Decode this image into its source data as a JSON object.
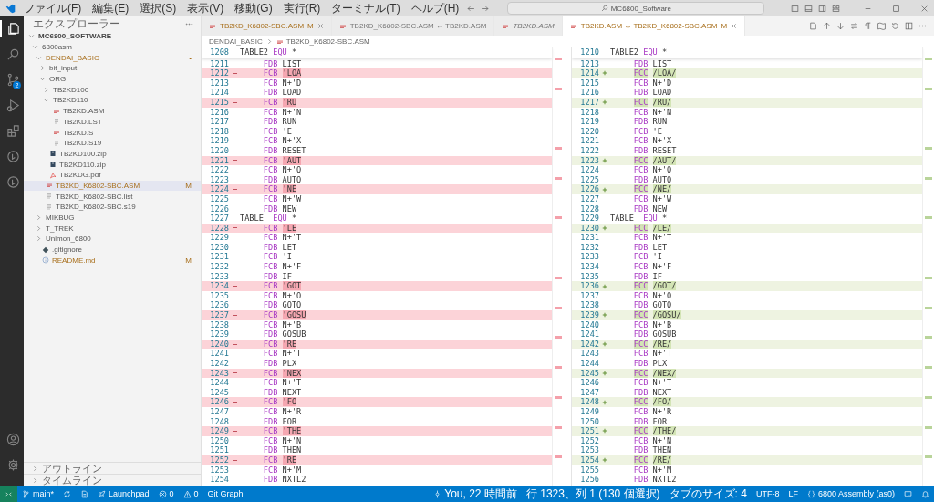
{
  "title_bar": {
    "menus": [
      "ファイル(F)",
      "編集(E)",
      "選択(S)",
      "表示(V)",
      "移動(G)",
      "実行(R)",
      "ターミナル(T)",
      "ヘルプ(H)"
    ],
    "search": {
      "value": "MC6800_Software"
    }
  },
  "activity_bar": {
    "items": [
      {
        "kind": "explorer",
        "selected": true
      },
      {
        "kind": "search",
        "selected": false
      },
      {
        "kind": "scm",
        "selected": false,
        "badge": "2"
      },
      {
        "kind": "run",
        "selected": false
      },
      {
        "kind": "extensions",
        "selected": false
      },
      {
        "kind": "circle",
        "selected": false
      },
      {
        "kind": "circle",
        "selected": false
      }
    ],
    "bottom": [
      {
        "kind": "account"
      },
      {
        "kind": "settings"
      }
    ]
  },
  "explorer": {
    "title": "エクスプローラー",
    "tree": [
      {
        "name": "MC6800_SOFTWARE",
        "kind": "root",
        "expanded": true,
        "selected": false,
        "children": [
          {
            "name": "6800asm",
            "kind": "folder",
            "expanded": true,
            "selected": false,
            "children": [
              {
                "name": "DENDAI_BASIC",
                "kind": "folder",
                "expanded": true,
                "selected": false,
                "badge": "•",
                "children": [
                  {
                    "name": "bit_input",
                    "kind": "folder",
                    "expanded": false,
                    "selected": false
                  },
                  {
                    "name": "ORG",
                    "kind": "folder",
                    "expanded": true,
                    "selected": false,
                    "children": [
                      {
                        "name": "TB2KD100",
                        "kind": "folder",
                        "expanded": false,
                        "selected": false
                      },
                      {
                        "name": "TB2KD110",
                        "kind": "folder",
                        "expanded": true,
                        "selected": false,
                        "children": [
                          {
                            "name": "TB2KD.ASM",
                            "kind": "asm",
                            "selected": false
                          },
                          {
                            "name": "TB2KD.LST",
                            "kind": "text",
                            "selected": false
                          },
                          {
                            "name": "TB2KD.S",
                            "kind": "asm",
                            "selected": false
                          },
                          {
                            "name": "TB2KD.S19",
                            "kind": "text",
                            "selected": false
                          }
                        ]
                      },
                      {
                        "name": "TB2KD100.zip",
                        "kind": "zip",
                        "selected": false
                      },
                      {
                        "name": "TB2KD110.zip",
                        "kind": "zip",
                        "selected": false
                      },
                      {
                        "name": "TB2KDG.pdf",
                        "kind": "pdf",
                        "selected": false
                      }
                    ]
                  },
                  {
                    "name": "TB2KD_K6802-SBC.ASM",
                    "kind": "asm",
                    "selected": true,
                    "badge": "M"
                  },
                  {
                    "name": "TB2KD_K6802-SBC.list",
                    "kind": "text",
                    "selected": false
                  },
                  {
                    "name": "TB2KD_K6802-SBC.s19",
                    "kind": "text",
                    "selected": false
                  }
                ]
              },
              {
                "name": "MIKBUG",
                "kind": "folder",
                "expanded": false,
                "selected": false
              },
              {
                "name": "T_TREK",
                "kind": "folder",
                "expanded": false,
                "selected": false
              },
              {
                "name": "Unimon_6800",
                "kind": "folder",
                "expanded": false,
                "selected": false
              },
              {
                "name": ".gitignore",
                "kind": "git",
                "selected": false
              },
              {
                "name": "README.md",
                "kind": "info",
                "selected": false,
                "badge": "M"
              }
            ]
          }
        ]
      }
    ],
    "sections": [
      {
        "title": "アウトライン",
        "expanded": false
      },
      {
        "title": "タイムライン",
        "expanded": false
      }
    ]
  },
  "tabs": [
    {
      "label": "TB2KD_K6802-SBC.ASM",
      "badge": "M",
      "close_button": true,
      "preview": false,
      "selected": false
    },
    {
      "label": "TB2KD_K6802-SBC.ASM ↔ TB2KD.ASM",
      "close_button": false,
      "preview": false,
      "selected": false
    },
    {
      "label": "TB2KD.ASM",
      "close_button": false,
      "preview": true,
      "selected": false
    },
    {
      "label": "TB2KD.ASM ↔ TB2KD_K6802-SBC.ASM",
      "badge": "M",
      "close_button": true,
      "preview": false,
      "selected": true
    }
  ],
  "breadcrumb": [
    "DENDAI_BASIC",
    "TB2KD_K6802-SBC.ASM"
  ],
  "panes": [
    {
      "sticky": {
        "n": "1208",
        "label": "TABLE2",
        "op": "EQU",
        "arg": "*"
      },
      "lines": [
        {
          "n": "1211",
          "kind": "same",
          "op": "FDB",
          "arg": "LIST"
        },
        {
          "n": "1212",
          "kind": "removed",
          "op": "FCB",
          "arg": "'LOA"
        },
        {
          "n": "1213",
          "kind": "same",
          "op": "FCB",
          "arg": "N+'D"
        },
        {
          "n": "1214",
          "kind": "same",
          "op": "FDB",
          "arg": "LOAD"
        },
        {
          "n": "1215",
          "kind": "removed",
          "op": "FCB",
          "arg": "'RU"
        },
        {
          "n": "1216",
          "kind": "same",
          "op": "FCB",
          "arg": "N+'N"
        },
        {
          "n": "1217",
          "kind": "same",
          "op": "FDB",
          "arg": "RUN"
        },
        {
          "n": "1218",
          "kind": "same",
          "op": "FCB",
          "arg": "'E"
        },
        {
          "n": "1219",
          "kind": "same",
          "op": "FCB",
          "arg": "N+'X"
        },
        {
          "n": "1220",
          "kind": "same",
          "op": "FDB",
          "arg": "RESET"
        },
        {
          "n": "1221",
          "kind": "removed",
          "op": "FCB",
          "arg": "'AUT"
        },
        {
          "n": "1222",
          "kind": "same",
          "op": "FCB",
          "arg": "N+'O"
        },
        {
          "n": "1223",
          "kind": "same",
          "op": "FDB",
          "arg": "AUTO"
        },
        {
          "n": "1224",
          "kind": "removed",
          "op": "FCB",
          "arg": "'NE"
        },
        {
          "n": "1225",
          "kind": "same",
          "op": "FCB",
          "arg": "N+'W"
        },
        {
          "n": "1226",
          "kind": "same",
          "op": "FDB",
          "arg": "NEW"
        },
        {
          "n": "1227",
          "kind": "same",
          "label": "TABLE",
          "op": "EQU",
          "arg": "*"
        },
        {
          "n": "1228",
          "kind": "removed",
          "op": "FCB",
          "arg": "'LE"
        },
        {
          "n": "1229",
          "kind": "same",
          "op": "FCB",
          "arg": "N+'T"
        },
        {
          "n": "1230",
          "kind": "same",
          "op": "FDB",
          "arg": "LET"
        },
        {
          "n": "1231",
          "kind": "same",
          "op": "FCB",
          "arg": "'I"
        },
        {
          "n": "1232",
          "kind": "same",
          "op": "FCB",
          "arg": "N+'F"
        },
        {
          "n": "1233",
          "kind": "same",
          "op": "FDB",
          "arg": "IF"
        },
        {
          "n": "1234",
          "kind": "removed",
          "op": "FCB",
          "arg": "'GOT"
        },
        {
          "n": "1235",
          "kind": "same",
          "op": "FCB",
          "arg": "N+'O"
        },
        {
          "n": "1236",
          "kind": "same",
          "op": "FDB",
          "arg": "GOTO"
        },
        {
          "n": "1237",
          "kind": "removed",
          "op": "FCB",
          "arg": "'GOSU"
        },
        {
          "n": "1238",
          "kind": "same",
          "op": "FCB",
          "arg": "N+'B"
        },
        {
          "n": "1239",
          "kind": "same",
          "op": "FDB",
          "arg": "GOSUB"
        },
        {
          "n": "1240",
          "kind": "removed",
          "op": "FCB",
          "arg": "'RE"
        },
        {
          "n": "1241",
          "kind": "same",
          "op": "FCB",
          "arg": "N+'T"
        },
        {
          "n": "1242",
          "kind": "same",
          "op": "FDB",
          "arg": "PLX"
        },
        {
          "n": "1243",
          "kind": "removed",
          "op": "FCB",
          "arg": "'NEX"
        },
        {
          "n": "1244",
          "kind": "same",
          "op": "FCB",
          "arg": "N+'T"
        },
        {
          "n": "1245",
          "kind": "same",
          "op": "FDB",
          "arg": "NEXT"
        },
        {
          "n": "1246",
          "kind": "removed",
          "op": "FCB",
          "arg": "'FO"
        },
        {
          "n": "1247",
          "kind": "same",
          "op": "FCB",
          "arg": "N+'R"
        },
        {
          "n": "1248",
          "kind": "same",
          "op": "FDB",
          "arg": "FOR"
        },
        {
          "n": "1249",
          "kind": "removed",
          "op": "FCB",
          "arg": "'THE"
        },
        {
          "n": "1250",
          "kind": "same",
          "op": "FCB",
          "arg": "N+'N"
        },
        {
          "n": "1251",
          "kind": "same",
          "op": "FDB",
          "arg": "THEN"
        },
        {
          "n": "1252",
          "kind": "removed",
          "op": "FCB",
          "arg": "'RE"
        },
        {
          "n": "1253",
          "kind": "same",
          "op": "FCB",
          "arg": "N+'M"
        },
        {
          "n": "1254",
          "kind": "same",
          "op": "FDB",
          "arg": "NXTL2"
        }
      ]
    },
    {
      "sticky": {
        "n": "1210",
        "label": "TABLE2",
        "op": "EQU",
        "arg": "*"
      },
      "lines": [
        {
          "n": "1213",
          "kind": "same",
          "op": "FDB",
          "arg": "LIST"
        },
        {
          "n": "1214",
          "kind": "added",
          "op": "FCC",
          "arg": "/LOA/"
        },
        {
          "n": "1215",
          "kind": "same",
          "op": "FCB",
          "arg": "N+'D"
        },
        {
          "n": "1216",
          "kind": "same",
          "op": "FDB",
          "arg": "LOAD"
        },
        {
          "n": "1217",
          "kind": "added",
          "op": "FCC",
          "arg": "/RU/"
        },
        {
          "n": "1218",
          "kind": "same",
          "op": "FCB",
          "arg": "N+'N"
        },
        {
          "n": "1219",
          "kind": "same",
          "op": "FDB",
          "arg": "RUN"
        },
        {
          "n": "1220",
          "kind": "same",
          "op": "FCB",
          "arg": "'E"
        },
        {
          "n": "1221",
          "kind": "same",
          "op": "FCB",
          "arg": "N+'X"
        },
        {
          "n": "1222",
          "kind": "same",
          "op": "FDB",
          "arg": "RESET"
        },
        {
          "n": "1223",
          "kind": "added",
          "op": "FCC",
          "arg": "/AUT/"
        },
        {
          "n": "1224",
          "kind": "same",
          "op": "FCB",
          "arg": "N+'O"
        },
        {
          "n": "1225",
          "kind": "same",
          "op": "FDB",
          "arg": "AUTO"
        },
        {
          "n": "1226",
          "kind": "added",
          "op": "FCC",
          "arg": "/NE/"
        },
        {
          "n": "1227",
          "kind": "same",
          "op": "FCB",
          "arg": "N+'W"
        },
        {
          "n": "1228",
          "kind": "same",
          "op": "FDB",
          "arg": "NEW"
        },
        {
          "n": "1229",
          "kind": "same",
          "label": "TABLE",
          "op": "EQU",
          "arg": "*"
        },
        {
          "n": "1230",
          "kind": "added",
          "op": "FCC",
          "arg": "/LE/"
        },
        {
          "n": "1231",
          "kind": "same",
          "op": "FCB",
          "arg": "N+'T"
        },
        {
          "n": "1232",
          "kind": "same",
          "op": "FDB",
          "arg": "LET"
        },
        {
          "n": "1233",
          "kind": "same",
          "op": "FCB",
          "arg": "'I"
        },
        {
          "n": "1234",
          "kind": "same",
          "op": "FCB",
          "arg": "N+'F"
        },
        {
          "n": "1235",
          "kind": "same",
          "op": "FDB",
          "arg": "IF"
        },
        {
          "n": "1236",
          "kind": "added",
          "op": "FCC",
          "arg": "/GOT/"
        },
        {
          "n": "1237",
          "kind": "same",
          "op": "FCB",
          "arg": "N+'O"
        },
        {
          "n": "1238",
          "kind": "same",
          "op": "FDB",
          "arg": "GOTO"
        },
        {
          "n": "1239",
          "kind": "added",
          "op": "FCC",
          "arg": "/GOSU/"
        },
        {
          "n": "1240",
          "kind": "same",
          "op": "FCB",
          "arg": "N+'B"
        },
        {
          "n": "1241",
          "kind": "same",
          "op": "FDB",
          "arg": "GOSUB"
        },
        {
          "n": "1242",
          "kind": "added",
          "op": "FCC",
          "arg": "/RE/"
        },
        {
          "n": "1243",
          "kind": "same",
          "op": "FCB",
          "arg": "N+'T"
        },
        {
          "n": "1244",
          "kind": "same",
          "op": "FDB",
          "arg": "PLX"
        },
        {
          "n": "1245",
          "kind": "added",
          "op": "FCC",
          "arg": "/NEX/"
        },
        {
          "n": "1246",
          "kind": "same",
          "op": "FCB",
          "arg": "N+'T"
        },
        {
          "n": "1247",
          "kind": "same",
          "op": "FDB",
          "arg": "NEXT"
        },
        {
          "n": "1248",
          "kind": "added",
          "op": "FCC",
          "arg": "/FO/"
        },
        {
          "n": "1249",
          "kind": "same",
          "op": "FCB",
          "arg": "N+'R"
        },
        {
          "n": "1250",
          "kind": "same",
          "op": "FDB",
          "arg": "FOR"
        },
        {
          "n": "1251",
          "kind": "added",
          "op": "FCC",
          "arg": "/THE/"
        },
        {
          "n": "1252",
          "kind": "same",
          "op": "FCB",
          "arg": "N+'N"
        },
        {
          "n": "1253",
          "kind": "same",
          "op": "FDB",
          "arg": "THEN"
        },
        {
          "n": "1254",
          "kind": "added",
          "op": "FCC",
          "arg": "/RE/"
        },
        {
          "n": "1255",
          "kind": "same",
          "op": "FCB",
          "arg": "N+'M"
        },
        {
          "n": "1256",
          "kind": "same",
          "op": "FDB",
          "arg": "NXTL2"
        }
      ]
    }
  ],
  "status_bar": {
    "left": [
      {
        "kind": "remote"
      },
      {
        "kind": "branch",
        "text": "main*"
      },
      {
        "kind": "sync"
      },
      {
        "kind": "doc"
      },
      {
        "kind": "launch",
        "text": "Launchpad"
      },
      {
        "kind": "error",
        "text": "0"
      },
      {
        "kind": "warning",
        "text": "0"
      },
      {
        "kind": "plain",
        "text": "Git Graph"
      }
    ],
    "right": [
      {
        "kind": "commit",
        "text": "You, 22 時間前"
      },
      {
        "kind": "plain",
        "text": "行 1323、列 1 (130 個選択)"
      },
      {
        "kind": "plain",
        "text": "タブのサイズ: 4"
      },
      {
        "kind": "plain",
        "text": "UTF-8"
      },
      {
        "kind": "plain",
        "text": "LF"
      },
      {
        "kind": "braces",
        "text": "6800 Assembly (as0)"
      },
      {
        "kind": "feedback"
      },
      {
        "kind": "bell"
      }
    ]
  }
}
